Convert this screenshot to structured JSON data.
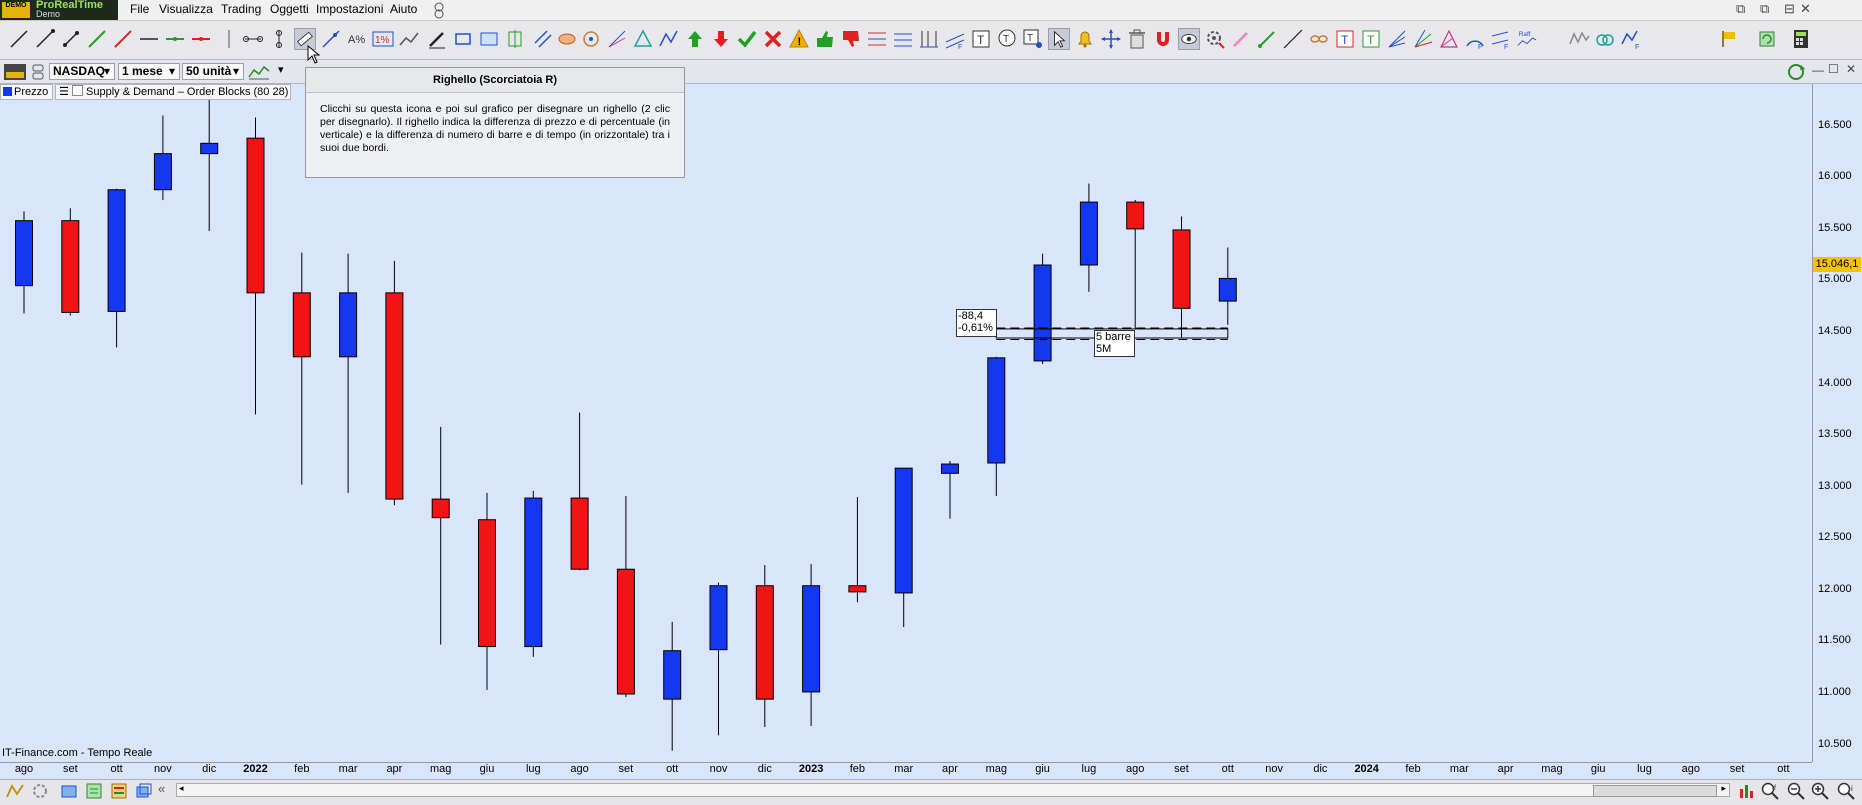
{
  "app": {
    "logo_name": "ProRealTime",
    "logo_sub": "Demo",
    "logo_badge": "DEMO"
  },
  "menu": [
    "File",
    "Visualizza",
    "Trading",
    "Oggetti",
    "Impostazioni",
    "Aiuto"
  ],
  "chart_controls": {
    "instrument": "NASDAQ",
    "period": "1 mese",
    "units": "50 unità",
    "legend_price": "Prezzo",
    "legend_indicator": "Supply & Demand – Order Blocks (80 28)"
  },
  "tooltip": {
    "title": "Righello (Scorciatoia R)",
    "body": "Clicchi su questa icona e poi sul grafico per disegnare un righello (2 clic per disegnarlo). Il righello indica la differenza di prezzo e di percentuale (in verticale) e la differenza di numero di barre e di tempo (in orizzontale) tra i suoi due bordi."
  },
  "ruler": {
    "price_diff": "-88,4",
    "pct_diff": "-0,61%",
    "bars": "5 barre",
    "time": "5M"
  },
  "source_label": "IT-Finance.com - Tempo Reale",
  "last_price": "15.046,1",
  "chart_data": {
    "type": "candlestick",
    "colors": {
      "up": "#1437f0",
      "down": "#f01414",
      "background": "#d9e5fb"
    },
    "ylim": [
      10350,
      16750
    ],
    "y_ticks": [
      "10.500",
      "11.000",
      "11.500",
      "12.000",
      "12.500",
      "13.000",
      "13.500",
      "14.000",
      "14.500",
      "15.000",
      "15.500",
      "16.000",
      "16.500"
    ],
    "x_labels": [
      "ago",
      "set",
      "ott",
      "nov",
      "dic",
      "2022",
      "feb",
      "mar",
      "apr",
      "mag",
      "giu",
      "lug",
      "ago",
      "set",
      "ott",
      "nov",
      "dic",
      "2023",
      "feb",
      "mar",
      "apr",
      "mag",
      "giu",
      "lug",
      "ago",
      "set",
      "ott",
      "nov",
      "dic",
      "2024",
      "feb",
      "mar",
      "apr",
      "mag",
      "giu",
      "lug",
      "ago",
      "set",
      "ott"
    ],
    "candles": [
      {
        "o": 14950,
        "h": 15670,
        "l": 14680,
        "c": 15580
      },
      {
        "o": 15580,
        "h": 15700,
        "l": 14660,
        "c": 14690
      },
      {
        "o": 14700,
        "h": 15890,
        "l": 14350,
        "c": 15880
      },
      {
        "o": 15880,
        "h": 16600,
        "l": 15780,
        "c": 16230
      },
      {
        "o": 16230,
        "h": 16750,
        "l": 15480,
        "c": 16330
      },
      {
        "o": 16380,
        "h": 16580,
        "l": 13700,
        "c": 14880
      },
      {
        "o": 14880,
        "h": 15270,
        "l": 13020,
        "c": 14260
      },
      {
        "o": 14260,
        "h": 15260,
        "l": 12940,
        "c": 14880
      },
      {
        "o": 14880,
        "h": 15190,
        "l": 12820,
        "c": 12880
      },
      {
        "o": 12880,
        "h": 13580,
        "l": 11470,
        "c": 12700
      },
      {
        "o": 12680,
        "h": 12940,
        "l": 11030,
        "c": 11450
      },
      {
        "o": 11450,
        "h": 12960,
        "l": 11350,
        "c": 12890
      },
      {
        "o": 12890,
        "h": 13720,
        "l": 12190,
        "c": 12200
      },
      {
        "o": 12200,
        "h": 12910,
        "l": 10960,
        "c": 10990
      },
      {
        "o": 10940,
        "h": 11690,
        "l": 10440,
        "c": 11410
      },
      {
        "o": 11420,
        "h": 12070,
        "l": 10590,
        "c": 12040
      },
      {
        "o": 12040,
        "h": 12240,
        "l": 10670,
        "c": 10940
      },
      {
        "o": 11010,
        "h": 12250,
        "l": 10680,
        "c": 12040
      },
      {
        "o": 12040,
        "h": 12900,
        "l": 11880,
        "c": 11980
      },
      {
        "o": 11970,
        "h": 13180,
        "l": 11640,
        "c": 13180
      },
      {
        "o": 13130,
        "h": 13250,
        "l": 12690,
        "c": 13220
      },
      {
        "o": 13230,
        "h": 14260,
        "l": 12910,
        "c": 14250
      },
      {
        "o": 14220,
        "h": 15260,
        "l": 14190,
        "c": 15150
      },
      {
        "o": 15150,
        "h": 15940,
        "l": 14890,
        "c": 15760
      },
      {
        "o": 15760,
        "h": 15780,
        "l": 14530,
        "c": 15500
      },
      {
        "o": 15490,
        "h": 15620,
        "l": 14450,
        "c": 14730
      },
      {
        "o": 14800,
        "h": 15320,
        "l": 14570,
        "c": 15020
      }
    ]
  }
}
